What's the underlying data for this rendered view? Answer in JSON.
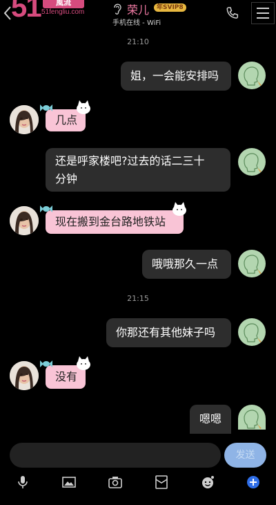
{
  "header": {
    "logo_number": "51",
    "logo_badge": "風流",
    "logo_site": "51fengliu.com",
    "contact_name": "荣儿",
    "svip_badge": "年SVIP8",
    "contact_status": "手机在线 - WiFi"
  },
  "messages": [
    {
      "type": "timestamp",
      "text": "21:10"
    },
    {
      "type": "sent",
      "text": "姐，一会能安排吗"
    },
    {
      "type": "received",
      "text": "几点"
    },
    {
      "type": "sent",
      "lines": [
        "还是呼家楼吧?过去的话二三十",
        "分钟"
      ]
    },
    {
      "type": "received",
      "text": "现在搬到金台路地铁站"
    },
    {
      "type": "sent",
      "text": "哦哦那久一点"
    },
    {
      "type": "timestamp",
      "text": "21:15"
    },
    {
      "type": "sent",
      "text": "你那还有其他妹子吗"
    },
    {
      "type": "received",
      "text": "没有"
    },
    {
      "type": "sent",
      "text": "嗯嗯"
    }
  ],
  "input": {
    "send_label": "发送"
  },
  "toolbar": {
    "icons": [
      "microphone-icon",
      "image-icon",
      "camera-icon",
      "red-packet-icon",
      "emoji-icon",
      "plus-icon"
    ]
  },
  "colors": {
    "background": "#000000",
    "sent_bubble": "#2d2d2d",
    "received_bubble": "#f9c4d6",
    "accent_pink": "#f07aa3",
    "send_button": "#8fb4e6"
  }
}
